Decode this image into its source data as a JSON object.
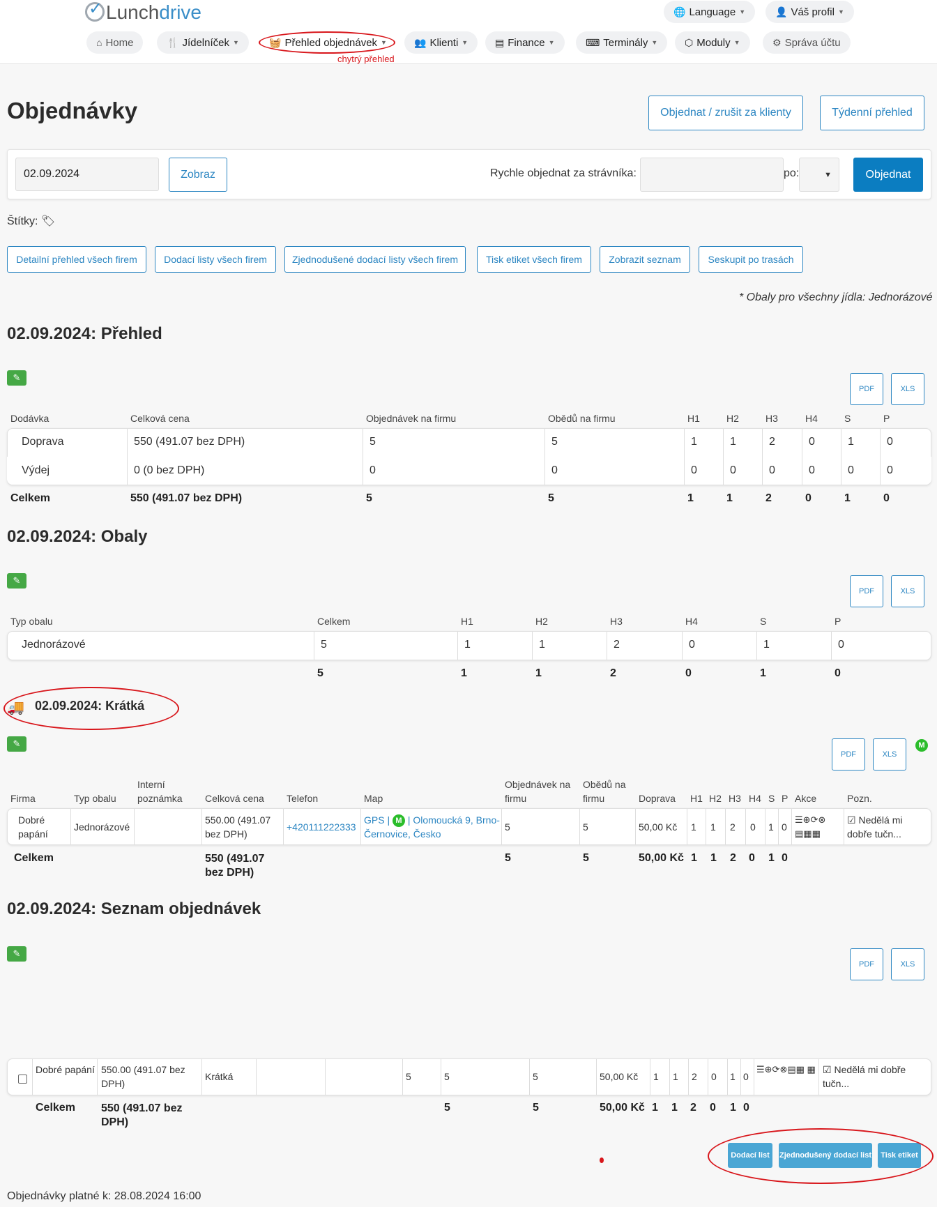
{
  "brand": {
    "part1": "Lunch",
    "part2": "drive"
  },
  "nav": {
    "language": "Language",
    "profile": "Váš profil",
    "items": [
      "Home",
      "Jídelníček",
      "Přehled objednávek",
      "Klienti",
      "Finance",
      "Terminály",
      "Moduly",
      "Správa účtu"
    ],
    "annotation": "chytrý přehled"
  },
  "page": {
    "title": "Objednávky",
    "btn_order_for_clients": "Objednat / zrušit za klienty",
    "btn_weekly": "Týdenní přehled",
    "date_value": "02.09.2024",
    "btn_show": "Zobraz",
    "quick_order_label": "Rychle objednat za strávníka:",
    "po_label": "po:",
    "btn_order": "Objednat",
    "tags_label": "Štítky:",
    "action_buttons": [
      "Detailní přehled všech firem",
      "Dodací listy všech firem",
      "Zjednodušené dodací listy všech firem",
      "Tisk etiket všech firem",
      "Zobrazit seznam",
      "Seskupit po trasách"
    ],
    "note": "* Obaly pro všechny jídla: Jednorázové",
    "pdf": "PDF",
    "xls": "XLS"
  },
  "overview": {
    "title": "02.09.2024: Přehled",
    "headers": [
      "Dodávka",
      "Celková cena",
      "Objednávek na firmu",
      "Obědů na firmu",
      "H1",
      "H2",
      "H3",
      "H4",
      "S",
      "P"
    ],
    "rows": [
      [
        "Doprava",
        "550 (491.07 bez DPH)",
        "5",
        "5",
        "1",
        "1",
        "2",
        "0",
        "1",
        "0"
      ],
      [
        "Výdej",
        "0 (0 bez DPH)",
        "0",
        "0",
        "0",
        "0",
        "0",
        "0",
        "0",
        "0"
      ]
    ],
    "total": [
      "Celkem",
      "550 (491.07 bez DPH)",
      "5",
      "5",
      "1",
      "1",
      "2",
      "0",
      "1",
      "0"
    ]
  },
  "packaging": {
    "title": "02.09.2024: Obaly",
    "headers": [
      "Typ obalu",
      "Celkem",
      "H1",
      "H2",
      "H3",
      "H4",
      "S",
      "P"
    ],
    "row": [
      "Jednorázové",
      "5",
      "1",
      "1",
      "2",
      "0",
      "1",
      "0"
    ],
    "total": [
      "5",
      "1",
      "1",
      "2",
      "0",
      "1",
      "0"
    ]
  },
  "route": {
    "title": "02.09.2024: Krátká",
    "headers": [
      "Firma",
      "Typ obalu",
      "Interní poznámka",
      "Celková cena",
      "Telefon",
      "Map",
      "Objednávek na firmu",
      "Obědů na firmu",
      "Doprava",
      "H1",
      "H2",
      "H3",
      "H4",
      "S",
      "P",
      "Akce",
      "Pozn."
    ],
    "row": {
      "firma": "Dobré papání",
      "typ": "Jednorázové",
      "cena": "550.00 (491.07 bez DPH)",
      "telefon": "+420111222333",
      "map_gps": "GPS",
      "map_badge": "M",
      "map_address": "Olomoucká 9, Brno-Černovice, Česko",
      "obj": "5",
      "obedu": "5",
      "doprava": "50,00 Kč",
      "h": [
        "1",
        "1",
        "2",
        "0",
        "1",
        "0"
      ],
      "akce": "☰⊕⟳⊗ ▤▦▦",
      "pozn": "Neděl​á mi dobře tučn..."
    },
    "total": {
      "label": "Celkem",
      "cena": "550 (491.07 bez DPH)",
      "obj": "5",
      "obedu": "5",
      "doprava": "50,00 Kč",
      "h": [
        "1",
        "1",
        "2",
        "0",
        "1",
        "0"
      ]
    }
  },
  "orders": {
    "title": "02.09.2024: Seznam objednávek",
    "row": {
      "firma": "Dobré papání",
      "cena": "550.00 (491.07 bez DPH)",
      "trasa": "Krátká",
      "c1": "5",
      "c2": "5",
      "c3": "5",
      "doprava": "50,00 Kč",
      "h": [
        "1",
        "1",
        "2",
        "0",
        "1",
        "0"
      ],
      "akce": "☰⊕⟳⊗▤▦ ▦",
      "pozn": "Neděl​á mi dobře tučn..."
    },
    "total": {
      "label": "Celkem",
      "cena": "550 (491.07 bez DPH)",
      "c2": "5",
      "c3": "5",
      "doprava": "50,00 Kč",
      "h": [
        "1",
        "1",
        "2",
        "0",
        "1",
        "0"
      ]
    },
    "btn_delivery": "Dodací list",
    "btn_simple_delivery": "Zjednodušený dodací list",
    "btn_labels": "Tisk etiket"
  },
  "footer": {
    "text": "Objednávky platné k: 28.08.2024 16:00"
  },
  "colors": {
    "primary": "#0b7dc1",
    "outline": "#2c86c2",
    "success": "#45a845",
    "annotation": "#d8161b"
  }
}
